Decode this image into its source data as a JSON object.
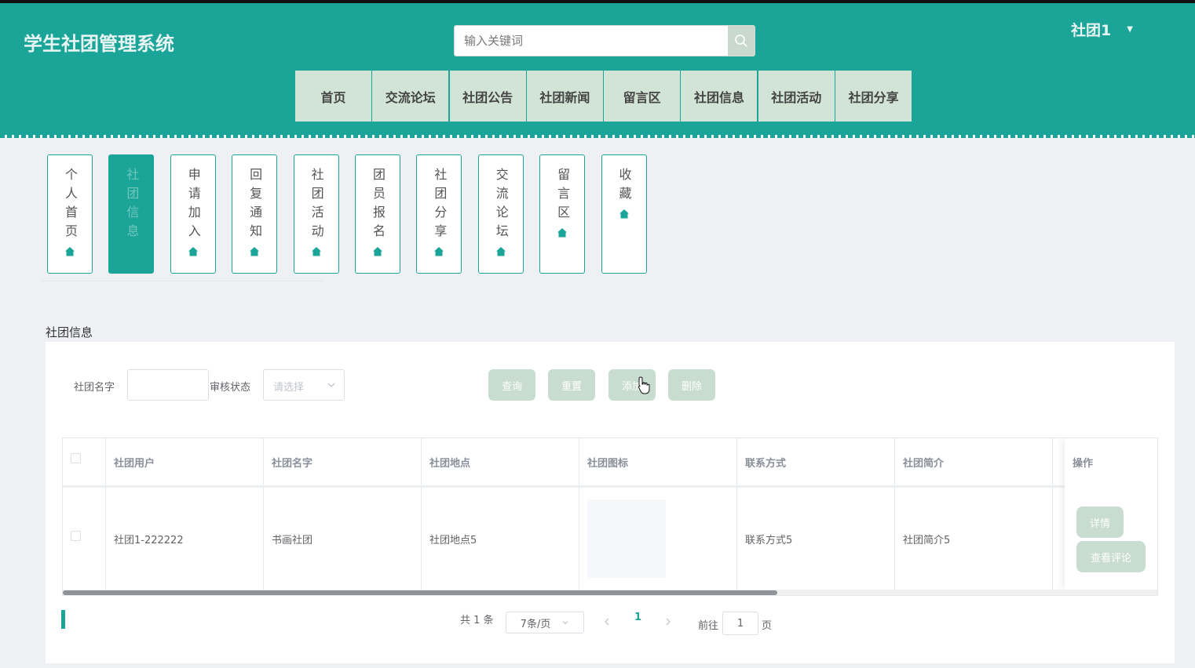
{
  "app": {
    "title": "学生社团管理系统",
    "brand_color": "#1ba598",
    "button_color": "#c8ddd0"
  },
  "search": {
    "placeholder": "输入关键词",
    "icon": "search-icon"
  },
  "user": {
    "name": "社团1",
    "caret_icon": "caret-down-icon"
  },
  "nav": [
    "首页",
    "交流论坛",
    "社团公告",
    "社团新闻",
    "留言区",
    "社团信息",
    "社团活动",
    "社团分享"
  ],
  "sidebar": {
    "active_index": 1,
    "items": [
      "个人首页",
      "社团信息",
      "申请加入",
      "回复通知",
      "社团活动",
      "团员报名",
      "社团分享",
      "交流论坛",
      "留言区",
      "收藏"
    ],
    "icon": "home-icon"
  },
  "section": {
    "title": "社团信息"
  },
  "filters": {
    "name_label": "社团名字",
    "name_value": "",
    "status_label": "审核状态",
    "status_placeholder": "请选择"
  },
  "buttons": {
    "query": "查询",
    "reset": "重置",
    "add": "添加",
    "delete": "删除"
  },
  "table": {
    "columns": [
      "社团用户",
      "社团名字",
      "社团地点",
      "社团图标",
      "联系方式",
      "社团简介",
      "操作"
    ],
    "rows": [
      {
        "user": "社团1-222222",
        "name": "书画社团",
        "location": "社团地点5",
        "icon": "",
        "contact": "联系方式5",
        "intro": "社团简介5"
      }
    ],
    "row_actions": [
      "详情",
      "查看评论"
    ]
  },
  "pagination": {
    "total": "共 1 条",
    "page_size": "7条/页",
    "current": "1",
    "goto_label": "前往",
    "goto_value": "1",
    "page_unit": "页"
  }
}
